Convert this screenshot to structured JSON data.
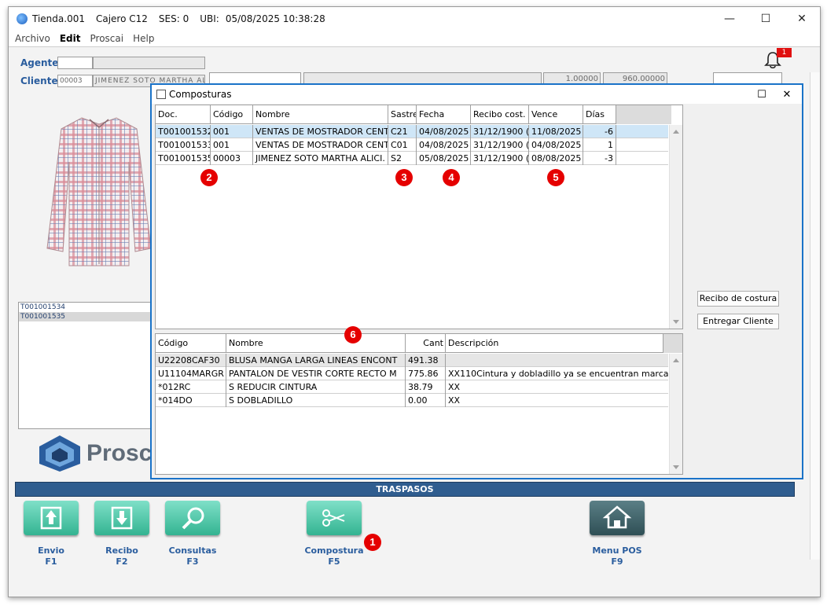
{
  "titlebar": {
    "store": "Tienda.001",
    "cashier": "Cajero C12",
    "session": "SES: 0",
    "location_label": "UBI:",
    "datetime": "05/08/2025 10:38:28",
    "minimize": "—",
    "maximize": "☐",
    "close": "✕"
  },
  "menu": {
    "items": [
      "Archivo",
      "Edit",
      "Proscai",
      "Help"
    ]
  },
  "form": {
    "agente_label": "Agente",
    "cliente_label": "Cliente",
    "cliente_code": "00003",
    "cliente_name": "JIMENEZ SOTO MARTHA ALI",
    "value1": "1.00000",
    "value2": "960.00000"
  },
  "notification": {
    "count": "1"
  },
  "doc_list": [
    "T001001534",
    "T001001535"
  ],
  "logo": {
    "text": "Prosc"
  },
  "dialog": {
    "title": "Composturas",
    "maximize": "☐",
    "close": "✕",
    "top_grid": {
      "headers": [
        "Doc.",
        "Código",
        "Nombre",
        "Sastre",
        "Fecha",
        "Recibo cost.",
        "Vence",
        "Días"
      ],
      "rows": [
        [
          "T001001532",
          "001",
          "VENTAS DE MOSTRADOR CENT",
          "C21",
          "04/08/2025",
          "31/12/1900 (",
          "11/08/2025",
          "-6"
        ],
        [
          "T001001533",
          "001",
          "VENTAS DE MOSTRADOR CENT",
          "C01",
          "04/08/2025",
          "31/12/1900 (",
          "04/08/2025",
          "1"
        ],
        [
          "T001001535",
          "00003",
          "JIMENEZ SOTO MARTHA ALICI.",
          "S2",
          "05/08/2025",
          "31/12/1900 (",
          "08/08/2025",
          "-3"
        ]
      ]
    },
    "bottom_grid": {
      "headers": [
        "Código",
        "Nombre",
        "Cant",
        "Descripción"
      ],
      "rows": [
        [
          "U22208CAF30",
          "BLUSA MANGA LARGA LINEAS ENCONT",
          "491.38",
          ""
        ],
        [
          "U11104MARGR",
          "PANTALON DE VESTIR CORTE RECTO M",
          "775.86",
          "XX110Cintura y dobladillo ya se encuentran marcac"
        ],
        [
          "*012RC",
          "S REDUCIR CINTURA",
          "38.79",
          "XX"
        ],
        [
          "*014DO",
          "S DOBLADILLO",
          "0.00",
          "XX"
        ]
      ]
    },
    "buttons": {
      "recibo": "Recibo de costura",
      "entregar": "Entregar Cliente"
    }
  },
  "markers": [
    "1",
    "2",
    "3",
    "4",
    "5",
    "6"
  ],
  "traspasos": "TRASPASOS",
  "fkeys": [
    {
      "label": "Envio",
      "key": "F1"
    },
    {
      "label": "Recibo",
      "key": "F2"
    },
    {
      "label": "Consultas",
      "key": "F3"
    },
    {
      "label": "Compostura",
      "key": "F5"
    },
    {
      "label": "Menu POS",
      "key": "F9"
    }
  ]
}
